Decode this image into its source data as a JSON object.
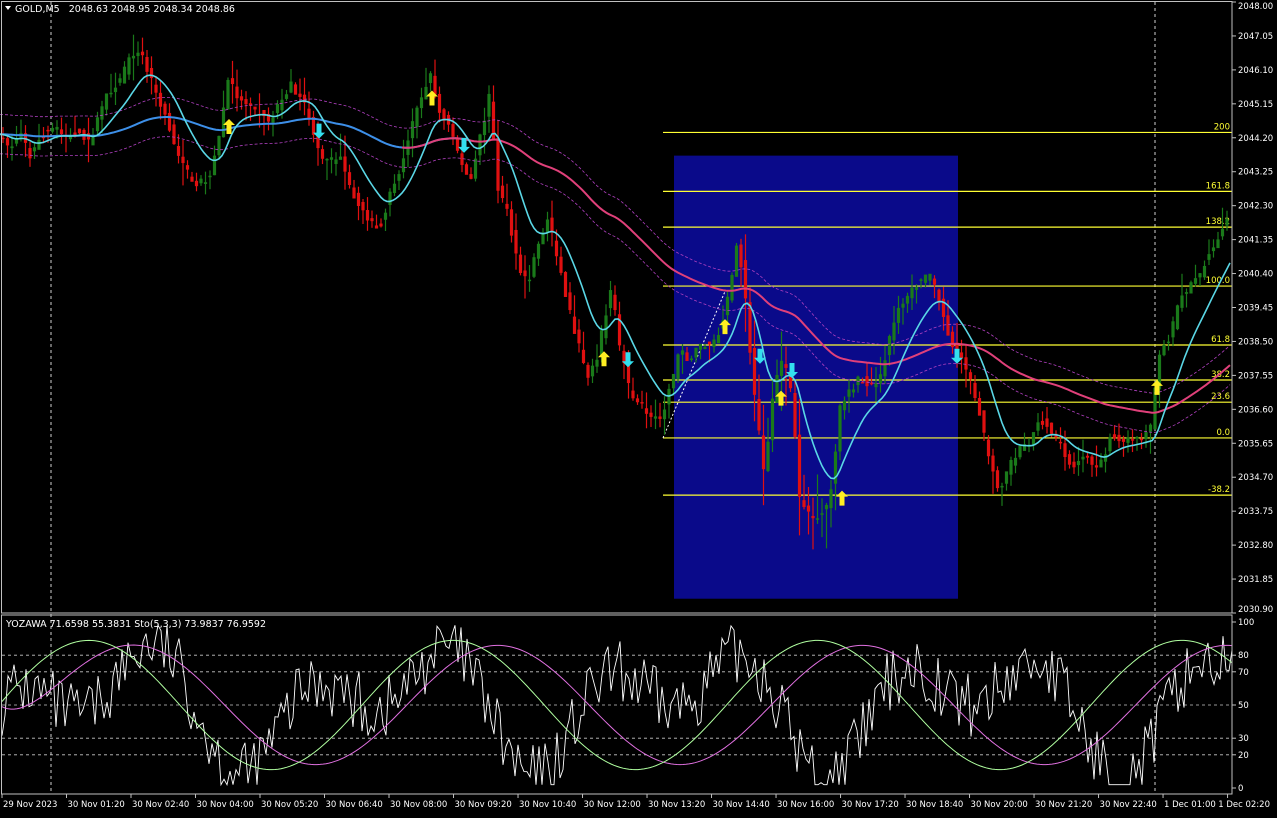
{
  "header": {
    "menu_icon": "triangle-down-icon",
    "symbol": "GOLD,M5",
    "ohlc": "2048.63 2048.95 2048.34 2048.86"
  },
  "indicator_header": {
    "label": "YOZAWA 71.6598 55.3831  Sto(5,3,3) 73.9837 76.9592"
  },
  "colors": {
    "background": "#000000",
    "frame": "#c0c0c0",
    "bull_bar": "#1a7a1a",
    "bear_bar": "#e01010",
    "ma_fast": "#5ad7e6",
    "ma_mid": "#3d8fe8",
    "ma_slow": "#e0407a",
    "band": "#b040c0",
    "fib": "#ffff33",
    "box": "#0a0a8a",
    "arrow_up": "#ffee22",
    "arrow_down": "#33dfee",
    "osc_main": "#ffffff",
    "osc_k": "#b0ffa0",
    "osc_d": "#e070e0"
  },
  "chart_data": {
    "type": "candlestick",
    "title": "GOLD,M5",
    "ylim": [
      2030.9,
      2048.0
    ],
    "y_ticks": [
      "2048.00",
      "2047.05",
      "2046.10",
      "2045.15",
      "2044.20",
      "2043.25",
      "2042.30",
      "2041.35",
      "2040.40",
      "2039.45",
      "2038.50",
      "2037.55",
      "2036.60",
      "2035.65",
      "2034.70",
      "2033.75",
      "2032.80",
      "2031.85",
      "2030.90"
    ],
    "x_ticks": [
      "29 Nov 2023",
      "30 Nov 01:20",
      "30 Nov 02:40",
      "30 Nov 04:00",
      "30 Nov 05:20",
      "30 Nov 06:40",
      "30 Nov 08:00",
      "30 Nov 09:20",
      "30 Nov 10:40",
      "30 Nov 12:00",
      "30 Nov 13:20",
      "30 Nov 14:40",
      "30 Nov 16:00",
      "30 Nov 17:20",
      "30 Nov 18:40",
      "30 Nov 20:00",
      "30 Nov 21:20",
      "30 Nov 22:40",
      "1 Dec 01:00",
      "1 Dec 02:20"
    ],
    "price_path": [
      [
        0,
        2044.3
      ],
      [
        12,
        2043.9
      ],
      [
        22,
        2044.3
      ],
      [
        32,
        2043.7
      ],
      [
        45,
        2044.3
      ],
      [
        55,
        2044.5
      ],
      [
        68,
        2044.2
      ],
      [
        82,
        2044.4
      ],
      [
        92,
        2044.0
      ],
      [
        102,
        2045.0
      ],
      [
        112,
        2045.5
      ],
      [
        122,
        2045.8
      ],
      [
        132,
        2046.4
      ],
      [
        142,
        2046.7
      ],
      [
        152,
        2045.9
      ],
      [
        162,
        2045.2
      ],
      [
        172,
        2044.5
      ],
      [
        182,
        2043.5
      ],
      [
        190,
        2043.2
      ],
      [
        200,
        2042.9
      ],
      [
        210,
        2043.0
      ],
      [
        220,
        2044.0
      ],
      [
        230,
        2045.9
      ],
      [
        240,
        2045.3
      ],
      [
        250,
        2045.0
      ],
      [
        262,
        2044.9
      ],
      [
        272,
        2044.6
      ],
      [
        282,
        2045.2
      ],
      [
        292,
        2045.7
      ],
      [
        302,
        2045.4
      ],
      [
        312,
        2044.8
      ],
      [
        322,
        2043.6
      ],
      [
        332,
        2043.5
      ],
      [
        342,
        2043.8
      ],
      [
        352,
        2042.9
      ],
      [
        362,
        2042.2
      ],
      [
        372,
        2041.9
      ],
      [
        382,
        2041.7
      ],
      [
        392,
        2042.6
      ],
      [
        402,
        2043.3
      ],
      [
        412,
        2044.3
      ],
      [
        422,
        2045.2
      ],
      [
        432,
        2046.0
      ],
      [
        442,
        2044.9
      ],
      [
        452,
        2044.5
      ],
      [
        462,
        2043.6
      ],
      [
        472,
        2043.0
      ],
      [
        482,
        2044.2
      ],
      [
        492,
        2045.4
      ],
      [
        500,
        2042.8
      ],
      [
        510,
        2042.1
      ],
      [
        520,
        2040.7
      ],
      [
        530,
        2040.1
      ],
      [
        540,
        2041.2
      ],
      [
        550,
        2041.9
      ],
      [
        560,
        2040.8
      ],
      [
        570,
        2039.5
      ],
      [
        580,
        2038.5
      ],
      [
        590,
        2037.4
      ],
      [
        598,
        2037.9
      ],
      [
        606,
        2039.0
      ],
      [
        614,
        2040.1
      ],
      [
        622,
        2038.3
      ],
      [
        632,
        2037.1
      ],
      [
        642,
        2036.8
      ],
      [
        652,
        2036.4
      ],
      [
        662,
        2036.2
      ],
      [
        672,
        2037.2
      ],
      [
        682,
        2038.2
      ],
      [
        692,
        2038.0
      ],
      [
        702,
        2038.4
      ],
      [
        712,
        2038.4
      ],
      [
        722,
        2038.8
      ],
      [
        732,
        2040.0
      ],
      [
        740,
        2041.4
      ],
      [
        748,
        2039.6
      ],
      [
        756,
        2037.1
      ],
      [
        766,
        2034.8
      ],
      [
        776,
        2037.2
      ],
      [
        786,
        2038.1
      ],
      [
        794,
        2037.0
      ],
      [
        802,
        2034.0
      ],
      [
        812,
        2033.7
      ],
      [
        822,
        2033.6
      ],
      [
        832,
        2034.1
      ],
      [
        842,
        2036.6
      ],
      [
        852,
        2037.1
      ],
      [
        862,
        2037.5
      ],
      [
        872,
        2037.3
      ],
      [
        882,
        2037.5
      ],
      [
        892,
        2038.6
      ],
      [
        902,
        2039.5
      ],
      [
        912,
        2039.9
      ],
      [
        922,
        2040.2
      ],
      [
        932,
        2040.3
      ],
      [
        942,
        2039.6
      ],
      [
        952,
        2038.6
      ],
      [
        962,
        2038.1
      ],
      [
        972,
        2037.4
      ],
      [
        982,
        2036.5
      ],
      [
        992,
        2035.0
      ],
      [
        1002,
        2034.3
      ],
      [
        1012,
        2035.0
      ],
      [
        1022,
        2035.5
      ],
      [
        1032,
        2035.6
      ],
      [
        1042,
        2036.4
      ],
      [
        1052,
        2036.0
      ],
      [
        1062,
        2035.6
      ],
      [
        1072,
        2035.0
      ],
      [
        1082,
        2035.2
      ],
      [
        1092,
        2035.2
      ],
      [
        1102,
        2035.0
      ],
      [
        1112,
        2035.8
      ],
      [
        1122,
        2035.8
      ],
      [
        1132,
        2035.7
      ],
      [
        1142,
        2035.8
      ],
      [
        1152,
        2035.9
      ],
      [
        1162,
        2038.3
      ],
      [
        1172,
        2038.6
      ],
      [
        1182,
        2039.7
      ],
      [
        1192,
        2040.0
      ],
      [
        1202,
        2040.4
      ],
      [
        1212,
        2041.0
      ],
      [
        1222,
        2041.5
      ],
      [
        1230,
        2041.9
      ]
    ],
    "fib_levels": [
      {
        "label": "200",
        "price": 2044.35
      },
      {
        "label": "161.8",
        "price": 2042.7
      },
      {
        "label": "138.2",
        "price": 2041.7
      },
      {
        "label": "100.0",
        "price": 2040.05
      },
      {
        "label": "61.8",
        "price": 2038.4
      },
      {
        "label": "38.2",
        "price": 2037.42
      },
      {
        "label": "23.6",
        "price": 2036.8
      },
      {
        "label": "0.0",
        "price": 2035.8
      },
      {
        "label": "-38.2",
        "price": 2034.2
      }
    ],
    "osc_levels": [
      "100",
      "80",
      "70",
      "50",
      "30",
      "20",
      "0"
    ],
    "arrows_up": [
      [
        229,
        2044.5
      ],
      [
        432,
        2045.3
      ],
      [
        604,
        2038.0
      ],
      [
        725,
        2038.9
      ],
      [
        781,
        2036.9
      ],
      [
        842,
        2034.1
      ],
      [
        1157,
        2037.2
      ]
    ],
    "arrows_down": [
      [
        319,
        2044.4
      ],
      [
        464,
        2044.0
      ],
      [
        628,
        2038.0
      ],
      [
        760,
        2038.1
      ],
      [
        792,
        2037.7
      ],
      [
        957,
        2038.1
      ]
    ]
  }
}
